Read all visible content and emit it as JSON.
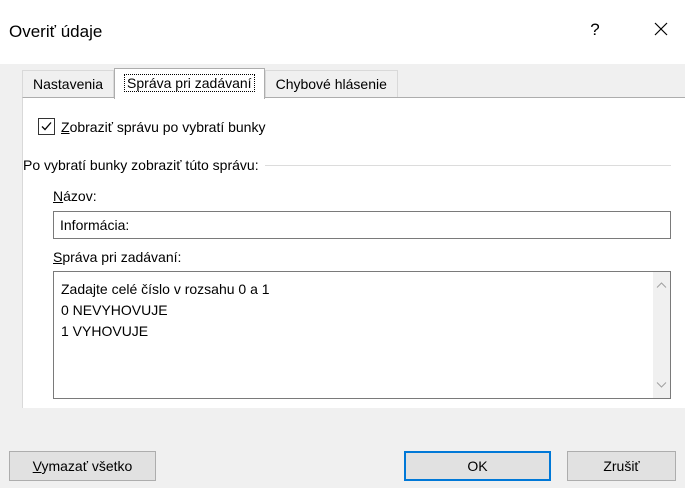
{
  "dialog": {
    "title": "Overiť údaje",
    "help_label": "?"
  },
  "tabs": [
    {
      "label": "Nastavenia",
      "active": false
    },
    {
      "label": "Správa pri zadávaní",
      "active": true
    },
    {
      "label": "Chybové hlásenie",
      "active": false
    }
  ],
  "input_message": {
    "show_checkbox": {
      "access_key": "Z",
      "label_rest": "obraziť správu po vybratí bunky",
      "checked": true
    },
    "group_label": "Po vybratí bunky zobraziť túto správu:",
    "title_field": {
      "access_key": "N",
      "label_rest": "ázov:",
      "value": "Informácia:"
    },
    "message_field": {
      "access_key": "S",
      "label_rest": "práva pri zadávaní:",
      "lines": [
        "Zadajte celé číslo v rozsahu 0 a 1",
        "0 NEVYHOVUJE",
        "1 VYHOVUJE"
      ]
    }
  },
  "buttons": {
    "clear_all": {
      "access_key": "V",
      "label_rest": "ymazať všetko"
    },
    "ok": "OK",
    "cancel": "Zrušiť"
  },
  "colors": {
    "accent": "#0078d7",
    "background": "#f0f0f0"
  }
}
